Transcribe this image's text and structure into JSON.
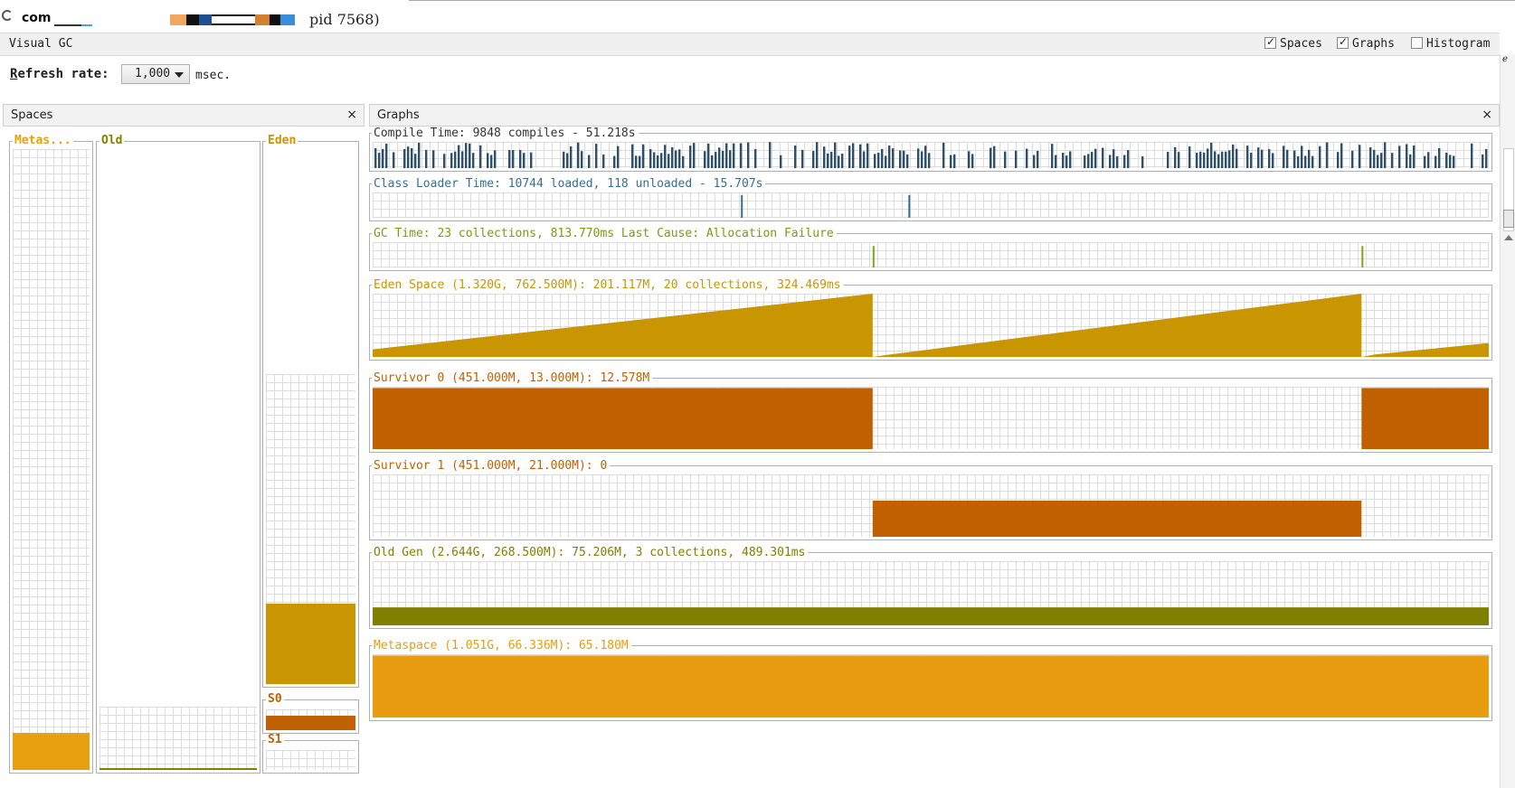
{
  "window": {
    "title_name": "com",
    "title_pid": "pid 7568)"
  },
  "header": {
    "title": "Visual GC",
    "options": [
      {
        "label": "Spaces",
        "checked": true
      },
      {
        "label": "Graphs",
        "checked": true
      },
      {
        "label": "Histogram",
        "checked": false
      }
    ]
  },
  "refresh": {
    "label_prefix": "R",
    "label_rest": "efresh rate:",
    "value": "1,000",
    "unit": "msec."
  },
  "spaces_panel": {
    "title": "Spaces",
    "close": "×",
    "columns": [
      {
        "label": "Metas...",
        "fill": 0.06,
        "color": "#e8a010"
      },
      {
        "label": "Old",
        "fill": 0.03,
        "color": "#808000"
      },
      {
        "label": "Eden",
        "fill": 0.26,
        "capacity": 0.58,
        "color": "#c99500"
      },
      {
        "label": "S0",
        "fill": 0.7,
        "color": "#c06000"
      },
      {
        "label": "S1",
        "fill": 0.0,
        "color": "#c06000"
      }
    ]
  },
  "graphs_panel": {
    "title": "Graphs",
    "close": "×",
    "graphs": [
      {
        "label": "Compile Time: 9848 compiles - 51.218s",
        "color": "#2f5068",
        "label_color": "#333333"
      },
      {
        "label": "Class Loader Time: 10744 loaded, 118 unloaded - 15.707s",
        "color": "#3a6d8f",
        "label_color": "#3a6d8f"
      },
      {
        "label": "GC Time: 23 collections, 813.770ms Last Cause: Allocation Failure",
        "color": "#7aa818",
        "label_color": "#7a9a10"
      },
      {
        "label": "Eden Space (1.320G, 762.500M): 201.117M, 20 collections, 324.469ms",
        "color": "#c99500",
        "label_color": "#c99500"
      },
      {
        "label": "Survivor 0 (451.000M, 13.000M): 12.578M",
        "color": "#c06000",
        "label_color": "#c06000"
      },
      {
        "label": "Survivor 1 (451.000M, 21.000M): 0",
        "color": "#c06000",
        "label_color": "#c06000"
      },
      {
        "label": "Old Gen (2.644G, 268.500M): 75.206M, 3 collections, 489.301ms",
        "color": "#808000",
        "label_color": "#808000"
      },
      {
        "label": "Metaspace (1.051G, 66.336M): 65.180M",
        "color": "#e89c10",
        "label_color": "#e89c10"
      }
    ]
  }
}
